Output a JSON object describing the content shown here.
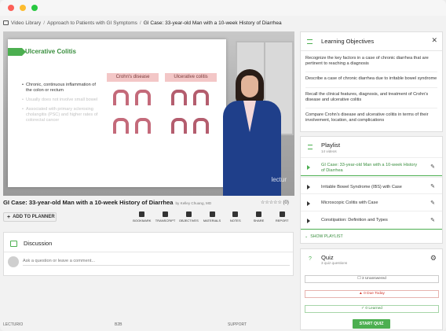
{
  "breadcrumb": {
    "items": [
      "Video Library",
      "Approach to Patients with GI Symptoms",
      "GI Case: 33-year-old Man with a 10-week History of Diarrhea"
    ]
  },
  "slide": {
    "title": "Ulcerative Colitis",
    "col_headers": [
      "Crohn's disease",
      "Ulcerative colitis"
    ],
    "bullets": [
      "Chronic, continuous inflammation of the colon or rectum",
      "Usually does not involve small bowel",
      "Associated with primary sclerosing cholangitis (PSC) and higher rates of colorectal cancer"
    ],
    "watermark": "lectur"
  },
  "video": {
    "title": "GI Case: 33-year-old Man with a 10-week History of Diarrhea",
    "byline": "by Kelley Chuang, MD",
    "rating": "☆☆☆☆☆ (0)",
    "add_to_planner": "ADD TO PLANNER"
  },
  "toolbar": [
    {
      "label": "BOOKMARK",
      "icon": "bookmark-icon"
    },
    {
      "label": "TRANSCRIPT",
      "icon": "transcript-icon"
    },
    {
      "label": "OBJECTIVES",
      "icon": "objectives-icon"
    },
    {
      "label": "MATERIALS",
      "icon": "materials-icon"
    },
    {
      "label": "NOTES",
      "icon": "notes-icon"
    },
    {
      "label": "SHARE",
      "icon": "share-icon"
    },
    {
      "label": "REPORT",
      "icon": "report-icon"
    }
  ],
  "discussion": {
    "title": "Discussion",
    "placeholder": "Ask a question or leave a comment..."
  },
  "footer": {
    "items": [
      "LECTURIO",
      "B2B",
      "SUPPORT"
    ]
  },
  "objectives": {
    "title": "Learning Objectives",
    "close": "✕",
    "items": [
      "Recognize the key factors in a case of chronic diarrhea that are pertinent to reaching a diagnosis",
      "Describe a case of chronic diarrhea due to irritable bowel syndrome",
      "Recall the clinical features, diagnosis, and treatment of Crohn's disease and ulcerative colitis",
      "Compare Crohn's disease and ulcerative colitis in terms of their involvement, location, and complications"
    ]
  },
  "playlist": {
    "title": "Playlist",
    "subtitle": "14 videos",
    "items": [
      "GI Case: 33-year-old Man with a 10-week History of Diarrhea",
      "Irritable Bowel Syndrome (IBS) with Case",
      "Microscopic Colitis with Case",
      "Constipation: Definition and Types"
    ],
    "show_label": "SHOW PLAYLIST"
  },
  "quiz": {
    "icon": "?",
    "title": "Quiz",
    "subtitle": "3 quiz questions",
    "unanswered": "3 Unanswered",
    "due_today": "0 Due Today",
    "learned": "0 Learned",
    "start": "START QUIZ"
  },
  "colors": {
    "accent": "#4caf50",
    "due": "#d0352b"
  }
}
